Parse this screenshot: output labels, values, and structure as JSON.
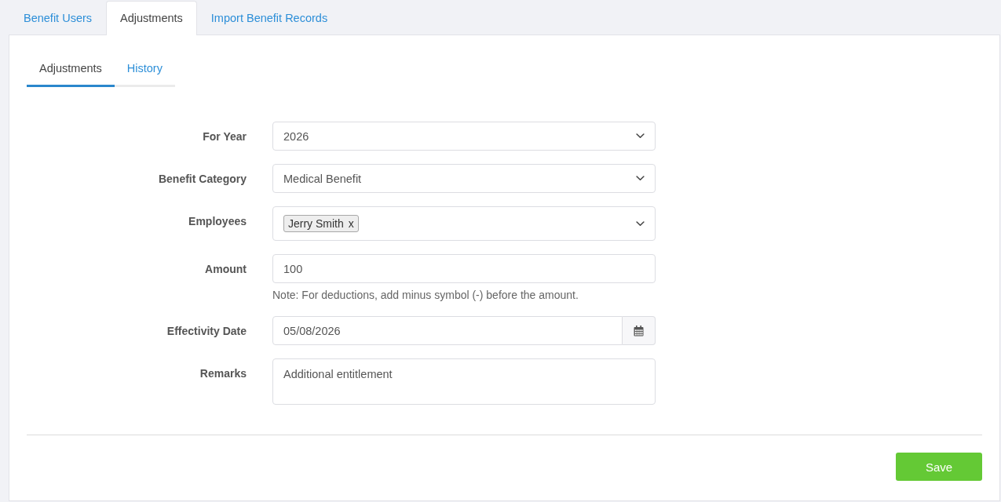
{
  "top_tabs": [
    {
      "label": "Benefit Users",
      "selected": false
    },
    {
      "label": "Adjustments",
      "selected": true
    },
    {
      "label": "Import Benefit Records",
      "selected": false
    }
  ],
  "sub_tabs": [
    {
      "label": "Adjustments",
      "selected": true
    },
    {
      "label": "History",
      "selected": false
    }
  ],
  "form": {
    "fields": [
      {
        "kind": "select",
        "label": "For Year",
        "value": "2026"
      },
      {
        "kind": "select",
        "label": "Benefit Category",
        "value": "Medical Benefit"
      },
      {
        "kind": "multiselect",
        "label": "Employees",
        "tags": [
          {
            "label": "Jerry Smith",
            "remove": "x"
          }
        ]
      },
      {
        "kind": "text",
        "label": "Amount",
        "value": "100",
        "note": "Note: For deductions, add minus symbol (-) before the amount."
      },
      {
        "kind": "date",
        "label": "Effectivity Date",
        "value": "05/08/2026"
      },
      {
        "kind": "textarea",
        "label": "Remarks",
        "value": "Additional entitlement"
      }
    ]
  },
  "buttons": [
    {
      "label": "Save"
    }
  ]
}
